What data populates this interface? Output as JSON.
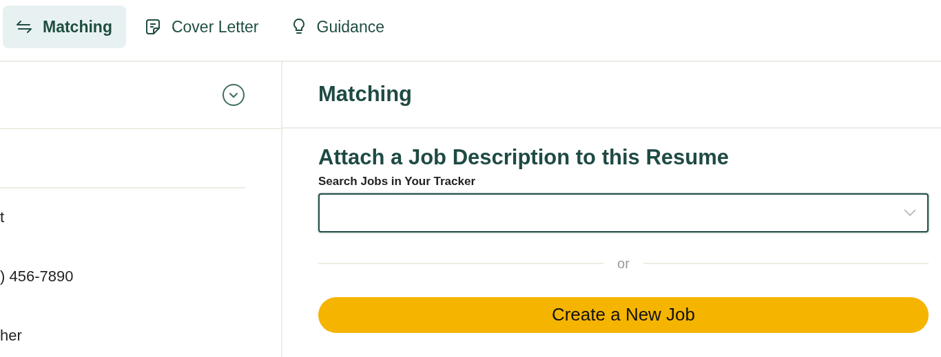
{
  "tabs": [
    {
      "label": "Matching",
      "kind": "swap",
      "selected": true
    },
    {
      "label": "Cover Letter",
      "kind": "note",
      "selected": false
    },
    {
      "label": "Guidance",
      "kind": "bulb",
      "selected": false
    }
  ],
  "resume_panel": {
    "lines": [
      "t",
      ") 456-7890",
      "her"
    ]
  },
  "matching": {
    "title": "Matching",
    "heading": "Attach a Job Description to this Resume",
    "search_label": "Search Jobs in Your Tracker",
    "divider": "or",
    "button": "Create a New Job"
  }
}
